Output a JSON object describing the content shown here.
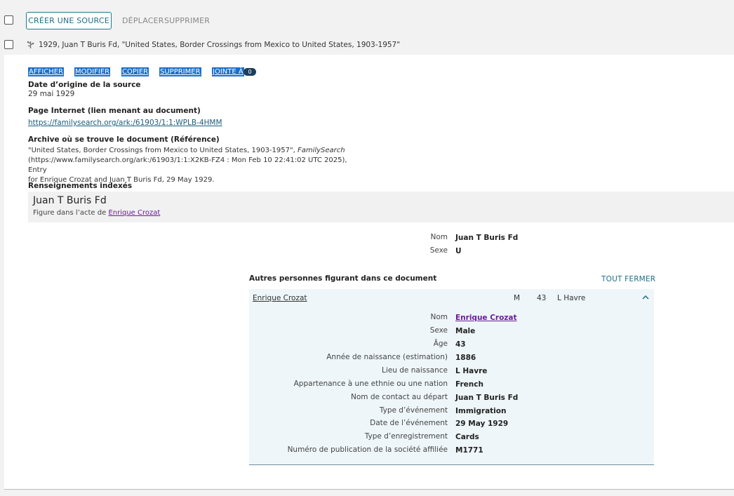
{
  "toolbar": {
    "create_label": "CRÉER UNE SOURCE",
    "move_label": "DÉPLACER",
    "delete_label": "SUPPRIMER"
  },
  "source": {
    "title": "1929, Juan T Buris Fd, \"United States, Border Crossings from Mexico to United States, 1903-1957\"",
    "actions": {
      "view": "AFFICHER",
      "edit": "MODIFIER",
      "copy": "COPIER",
      "delete": "SUPPRIMER",
      "attached": "JOINTE À",
      "attached_count": "0"
    },
    "date_label": "Date d’origine de la source",
    "date_value": "29 mai 1929",
    "web_label": "Page Internet (lien menant au document)",
    "web_url": "https://familysearch.org/ark:/61903/1:1:WPLB-4HMM",
    "archive_label": "Archive où se trouve le document (Référence)",
    "citation_line1_a": "\"United States, Border Crossings from Mexico to United States, 1903-1957\",",
    "citation_line1_b": "FamilySearch",
    "citation_line2": "(https://www.familysearch.org/ark:/61903/1:1:X2KB-FZ4 : Mon Feb 10 22:41:02 UTC 2025), Entry",
    "citation_line3": "for Enrique Crozat and Juan T Buris Fd, 29 May 1929.",
    "indexed_label": "Renseignements indexés"
  },
  "indexed_person": {
    "name": "Juan T Buris Fd",
    "sub_prefix": "Figure dans l’acte de",
    "sub_link": "Enrique Crozat",
    "fields": [
      {
        "key": "Nom",
        "value": "Juan T Buris Fd"
      },
      {
        "key": "Sexe",
        "value": "U"
      }
    ]
  },
  "others": {
    "title": "Autres personnes figurant dans ce document",
    "close_all": "TOUT FERMER",
    "row": {
      "name": "Enrique Crozat",
      "sex": "M",
      "age": "43",
      "place": "L Havre"
    },
    "fields": [
      {
        "key": "Nom",
        "value": "Enrique Crozat"
      },
      {
        "key": "Sexe",
        "value": "Male"
      },
      {
        "key": "Âge",
        "value": "43"
      },
      {
        "key": "Année de naissance (estimation)",
        "value": "1886"
      },
      {
        "key": "Lieu de naissance",
        "value": "L Havre"
      },
      {
        "key": "Appartenance à une ethnie ou une nation",
        "value": "French"
      },
      {
        "key": "Nom de contact au départ",
        "value": "Juan T Buris Fd"
      },
      {
        "key": "Type d’événement",
        "value": "Immigration"
      },
      {
        "key": "Date de l’événement",
        "value": "29 May 1929"
      },
      {
        "key": "Type d’enregistrement",
        "value": "Cards"
      },
      {
        "key": "Numéro de publication de la société affiliée",
        "value": "M1771"
      }
    ]
  },
  "colors": {
    "accent": "#1f6f86",
    "highlight": "#1a6fc9",
    "link_visited": "#6a1b9a",
    "panel_bg": "#eef6f9"
  },
  "icons": [
    "tree-icon",
    "chevron-up-icon"
  ]
}
